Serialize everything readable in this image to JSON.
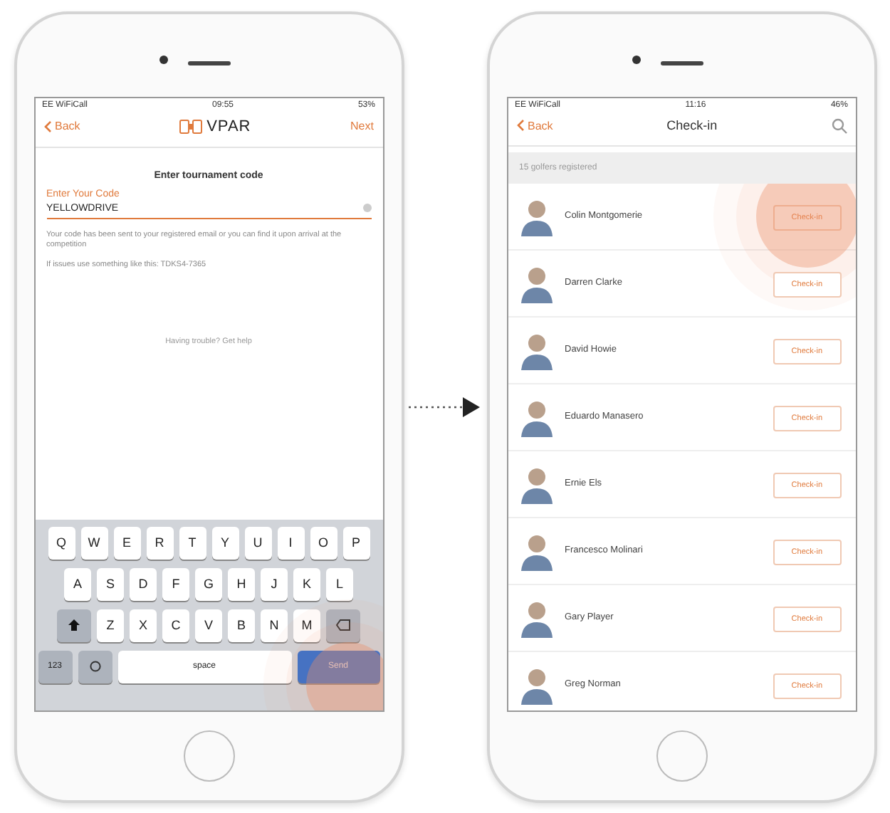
{
  "phones": [
    {
      "kind": "code_entry",
      "status_bar": {
        "carrier": "EE WiFiCall",
        "time": "09:55",
        "battery": "53%"
      },
      "nav": {
        "back": "Back",
        "title": "VPAR",
        "action": "Next"
      },
      "heading": "Enter tournament code",
      "field": {
        "label": "Enter Your Code",
        "value": "YELLOWDRIVE"
      },
      "notes": [
        "Your code has been sent to your registered email or you can find it upon arrival at the competition",
        "If issues use something like this: TDKS4-7365"
      ],
      "help": "Having trouble? Get help",
      "keyboard": {
        "rows": [
          [
            "Q",
            "W",
            "E",
            "R",
            "T",
            "Y",
            "U",
            "I",
            "O",
            "P"
          ],
          [
            "A",
            "S",
            "D",
            "F",
            "G",
            "H",
            "J",
            "K",
            "L"
          ],
          [
            "Z",
            "X",
            "C",
            "V",
            "B",
            "N",
            "M"
          ]
        ],
        "numbers": "123",
        "space": "space",
        "send": "Send"
      },
      "tap": true
    },
    {
      "kind": "check_in",
      "status_bar": {
        "carrier": "EE WiFiCall",
        "time": "11:16",
        "battery": "46%"
      },
      "nav": {
        "back": "Back",
        "title": "Check-in"
      },
      "section": "15 golfers registered",
      "players": [
        {
          "name": "Colin Montgomerie",
          "button": "Check-in",
          "tap": true
        },
        {
          "name": "Darren Clarke",
          "button": "Check-in",
          "tap": false
        },
        {
          "name": "David Howie",
          "button": "Check-in",
          "tap": false
        },
        {
          "name": "Eduardo Manasero",
          "button": "Check-in",
          "tap": false
        },
        {
          "name": "Ernie Els",
          "button": "Check-in",
          "tap": false
        },
        {
          "name": "Francesco Molinari",
          "button": "Check-in",
          "tap": false
        },
        {
          "name": "Gary Player",
          "button": "Check-in",
          "tap": false
        },
        {
          "name": "Greg Norman",
          "button": "Check-in",
          "tap": false
        }
      ]
    }
  ]
}
